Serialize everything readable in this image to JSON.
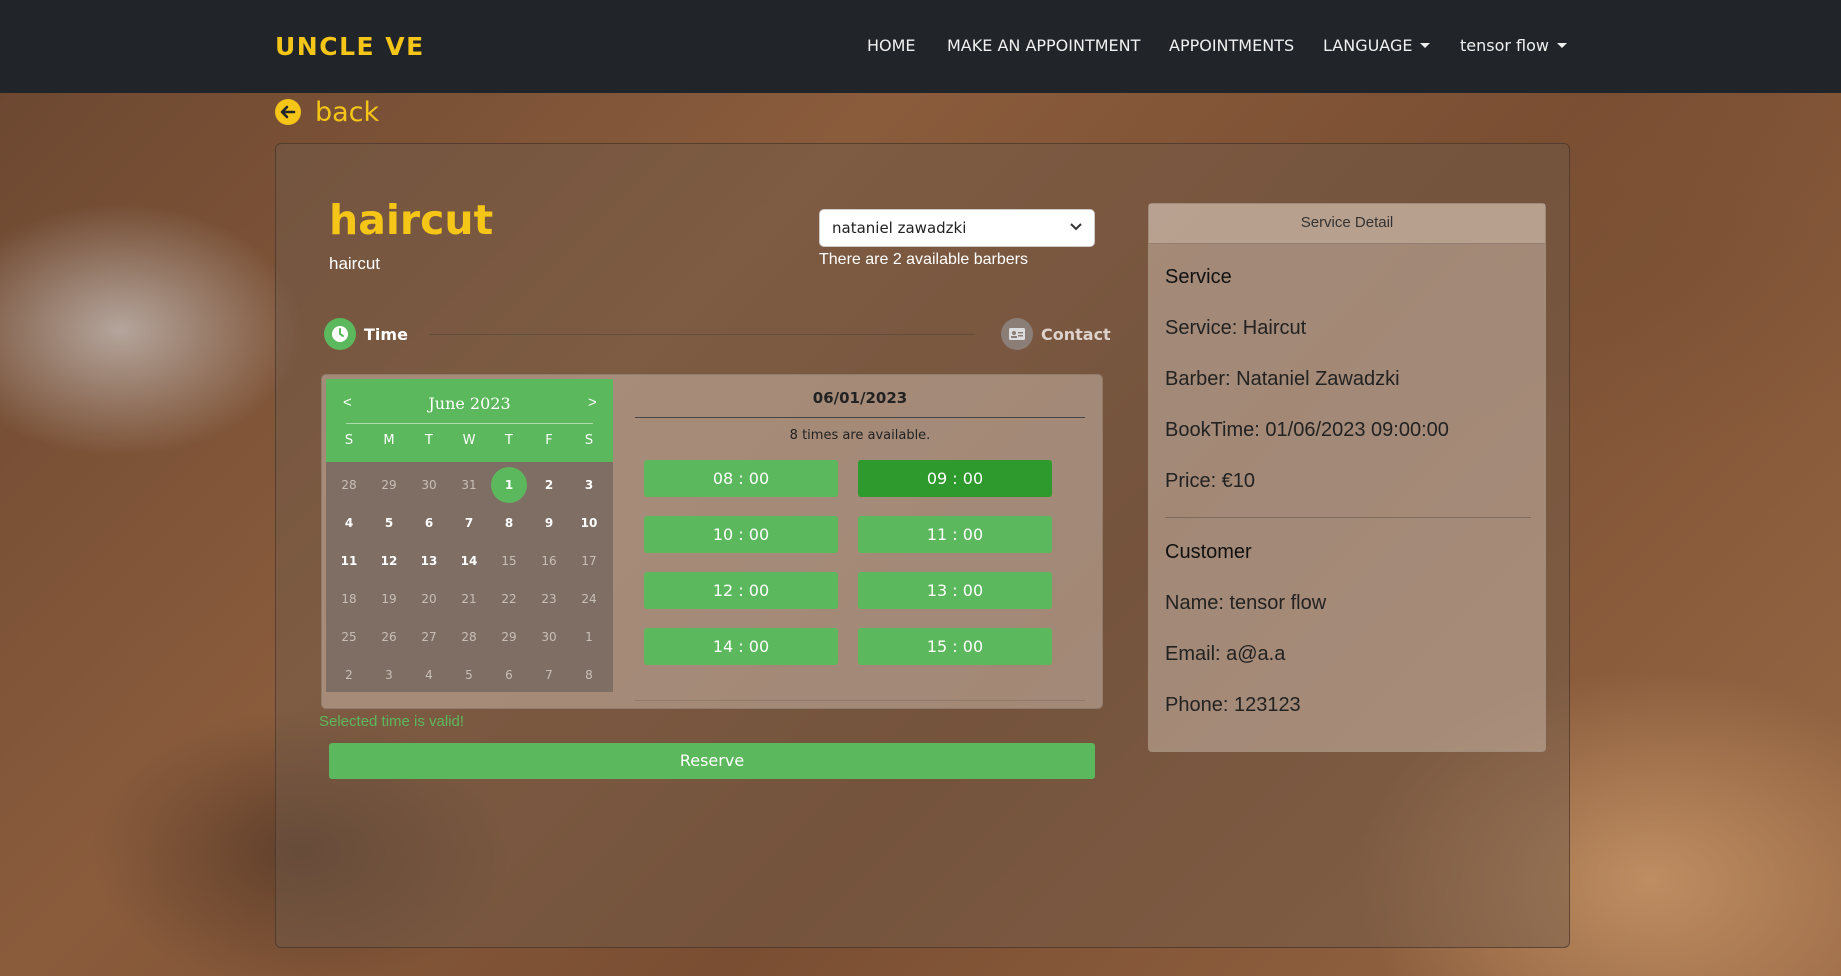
{
  "nav": {
    "brand": "UNCLE VE",
    "home": "HOME",
    "make_appointment": "MAKE AN APPOINTMENT",
    "appointments": "APPOINTMENTS",
    "language": "LANGUAGE",
    "user": "tensor flow"
  },
  "back": {
    "label": "back"
  },
  "service": {
    "title": "haircut",
    "subtitle": "haircut"
  },
  "barber": {
    "selected": "nataniel zawadzki",
    "hint": "There are 2 available barbers"
  },
  "steps": {
    "time": "Time",
    "contact": "Contact"
  },
  "calendar": {
    "prev": "<",
    "next": ">",
    "month": "June 2023",
    "weekdays": [
      "S",
      "M",
      "T",
      "W",
      "T",
      "F",
      "S"
    ],
    "weeks": [
      [
        "28",
        "29",
        "30",
        "31",
        "1",
        "2",
        "3"
      ],
      [
        "4",
        "5",
        "6",
        "7",
        "8",
        "9",
        "10"
      ],
      [
        "11",
        "12",
        "13",
        "14",
        "15",
        "16",
        "17"
      ],
      [
        "18",
        "19",
        "20",
        "21",
        "22",
        "23",
        "24"
      ],
      [
        "25",
        "26",
        "27",
        "28",
        "29",
        "30",
        "1"
      ],
      [
        "2",
        "3",
        "4",
        "5",
        "6",
        "7",
        "8"
      ]
    ],
    "selected_day": "1"
  },
  "slots": {
    "date": "06/01/2023",
    "available": "8 times are available.",
    "times": [
      "08 : 00",
      "09 : 00",
      "10 : 00",
      "11 : 00",
      "12 : 00",
      "13 : 00",
      "14 : 00",
      "15 : 00"
    ],
    "chosen": "09 : 00"
  },
  "status": {
    "valid": "Selected time is valid!"
  },
  "reserve": {
    "label": "Reserve"
  },
  "detail": {
    "header": "Service Detail",
    "service_heading": "Service",
    "service": "Service: Haircut",
    "barber": "Barber: Nataniel Zawadzki",
    "booktime": "BookTime: 01/06/2023 09:00:00",
    "price": "Price: €10",
    "customer_heading": "Customer",
    "name": "Name: tensor flow",
    "email": "Email: a@a.a",
    "phone": "Phone: 123123"
  },
  "colors": {
    "accent": "#f5c518",
    "success": "#5cb85c",
    "navbar": "#212529"
  }
}
